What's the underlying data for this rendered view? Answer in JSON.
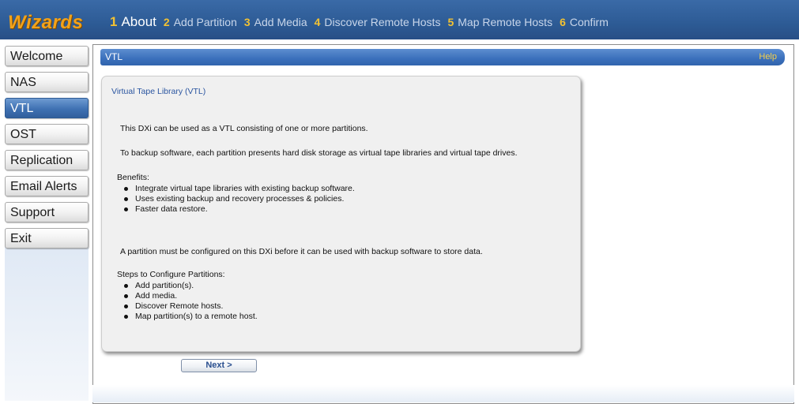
{
  "header": {
    "logo_text": "Wizards",
    "steps": [
      {
        "num": "1",
        "label": "About"
      },
      {
        "num": "2",
        "label": "Add Partition"
      },
      {
        "num": "3",
        "label": "Add Media"
      },
      {
        "num": "4",
        "label": "Discover Remote Hosts"
      },
      {
        "num": "5",
        "label": "Map Remote Hosts"
      },
      {
        "num": "6",
        "label": "Confirm"
      }
    ],
    "active_step": "1"
  },
  "nav": {
    "items": [
      {
        "label": "Welcome"
      },
      {
        "label": "NAS"
      },
      {
        "label": "VTL"
      },
      {
        "label": "OST"
      },
      {
        "label": "Replication"
      },
      {
        "label": "Email Alerts"
      },
      {
        "label": "Support"
      },
      {
        "label": "Exit"
      }
    ],
    "active": "VTL"
  },
  "content": {
    "section_title": "VTL",
    "help_label": "Help",
    "panel_title": "Virtual Tape Library (VTL)",
    "intro": "This DXi can be used as a VTL consisting of one or more partitions.",
    "description": "To backup software, each partition presents hard disk storage as virtual tape libraries and virtual tape drives.",
    "benefits_heading": "Benefits:",
    "benefits": [
      "Integrate virtual tape libraries with existing backup software.",
      "Uses existing backup and recovery processes & policies.",
      "Faster data restore."
    ],
    "partition_note": "A partition must be configured on this DXi before it can be used with backup software to store data.",
    "steps_heading": "Steps to Configure Partitions:",
    "steps": [
      "Add partition(s).",
      "Add media.",
      "Discover Remote hosts.",
      "Map partition(s) to a remote host."
    ]
  },
  "footer": {
    "next_label": "Next >"
  },
  "colors": {
    "header_bg": "#2d5b95",
    "logo": "#f2a21a",
    "step_number": "#f3c232",
    "active_nav": "#3f71b3",
    "help_link": "#f5d04a"
  }
}
